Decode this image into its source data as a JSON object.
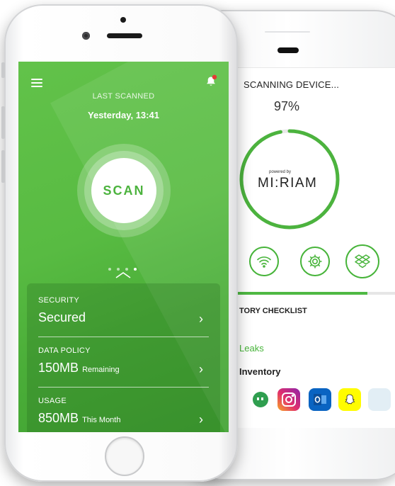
{
  "front": {
    "last_scanned_label": "LAST SCANNED",
    "last_scanned_time": "Yesterday, 13:41",
    "scan_button_label": "SCAN",
    "page_indicator": {
      "count": 4,
      "active_index": 3
    },
    "rows": [
      {
        "label": "SECURITY",
        "value": "Secured",
        "suffix": ""
      },
      {
        "label": "DATA POLICY",
        "value": "150MB",
        "suffix": "Remaining"
      },
      {
        "label": "USAGE",
        "value": "850MB",
        "suffix": "This Month"
      }
    ]
  },
  "back": {
    "title": "SCANNING DEVICE...",
    "percent_text": "97%",
    "progress_fraction": 0.97,
    "powered_by": "powered by",
    "brand": "MI:RIAM",
    "scan_icons": [
      "wifi-icon",
      "gear-icon",
      "dropbox-icon"
    ],
    "bar_progress_fraction": 0.83,
    "checklist_label": "TORY CHECKLIST",
    "leaks_label": "Leaks",
    "inventory_label": "Inventory",
    "apps": [
      "hangouts-icon",
      "instagram-icon",
      "outlook-icon",
      "snapchat-icon",
      "app-icon"
    ]
  },
  "colors": {
    "accent_green": "#4cb33e",
    "notification_red": "#e53935"
  }
}
